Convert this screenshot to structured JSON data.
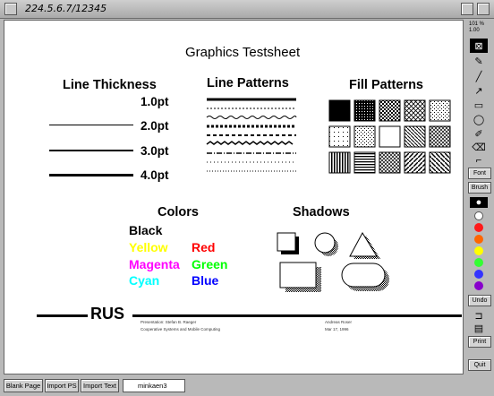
{
  "window": {
    "title": "224.5.6.7/12345"
  },
  "canvas": {
    "title": "Graphics Testsheet",
    "line_thickness": {
      "heading": "Line Thickness",
      "items": [
        "1.0pt",
        "2.0pt",
        "3.0pt",
        "4.0pt"
      ]
    },
    "line_patterns": {
      "heading": "Line Patterns"
    },
    "fill_patterns": {
      "heading": "Fill Patterns"
    },
    "colors": {
      "heading": "Colors",
      "black": "Black",
      "yellow": "Yellow",
      "red": "Red",
      "magenta": "Magenta",
      "green": "Green",
      "cyan": "Cyan",
      "blue": "Blue",
      "hex": {
        "black": "#000000",
        "yellow": "#ffff00",
        "red": "#ff0000",
        "magenta": "#ff00ff",
        "green": "#00ff00",
        "cyan": "#00ffff",
        "blue": "#0000ff"
      }
    },
    "shadows": {
      "heading": "Shadows"
    },
    "footer": {
      "logo": "RUS",
      "credit_line1": "Presentation: Stefan B. Raeger",
      "credit_line2": "Cooperative Systems and Mobile Computing",
      "author": "Andreas Roser",
      "date": "Mar 17, 1996"
    }
  },
  "toolbar": {
    "top_label": "101 %",
    "top_label2": "1.00",
    "tools": [
      "select-tool",
      "pencil-tool",
      "line-tool",
      "arrow-tool",
      "rectangle-tool",
      "ellipse-tool",
      "freehand-tool",
      "eraser-tool",
      "connector-tool"
    ],
    "font_label": "Font",
    "brush_label": "Brush",
    "palette": [
      "#ffffff",
      "#ff1a1a",
      "#ff6600",
      "#ffff00",
      "#33ff33",
      "#3333ff",
      "#8800cc"
    ],
    "undo_label": "Undo",
    "print_label": "Print",
    "quit_label": "Quit"
  },
  "bottombar": {
    "blank_page": "Blank Page",
    "import_ps": "Import PS",
    "import_text": "Import Text",
    "field_value": "minkaen3"
  }
}
